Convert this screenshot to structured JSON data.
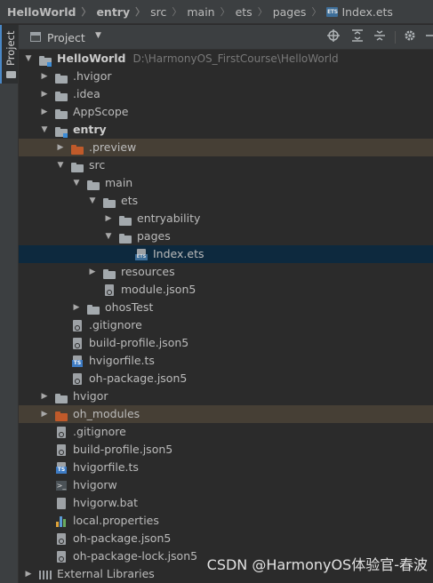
{
  "breadcrumb": {
    "items": [
      "HelloWorld",
      "entry",
      "src",
      "main",
      "ets",
      "pages",
      "Index.ets"
    ],
    "ets_badge": "ETS"
  },
  "side_stripe": {
    "label": "Project"
  },
  "toolbar": {
    "title": "Project",
    "dropdown_glyph": "▼",
    "buttons": [
      "locate-icon",
      "expand-all-icon",
      "collapse-all-icon",
      "gear-icon",
      "minimize-icon"
    ]
  },
  "tree": {
    "project_path": "D:\\HarmonyOS_FirstCourse\\HelloWorld",
    "rows": [
      {
        "label": "HelloWorld",
        "icon": "module-folder-icon",
        "arrow": "down",
        "depth": 0
      },
      {
        "label": ".hvigor",
        "icon": "folder-icon",
        "arrow": "right",
        "depth": 1
      },
      {
        "label": ".idea",
        "icon": "folder-icon",
        "arrow": "right",
        "depth": 1
      },
      {
        "label": "AppScope",
        "icon": "folder-icon",
        "arrow": "right",
        "depth": 1
      },
      {
        "label": "entry",
        "icon": "module-folder-icon",
        "arrow": "down",
        "depth": 1
      },
      {
        "label": ".preview",
        "icon": "orange-folder-icon",
        "arrow": "right",
        "depth": 2
      },
      {
        "label": "src",
        "icon": "folder-icon",
        "arrow": "down",
        "depth": 2
      },
      {
        "label": "main",
        "icon": "folder-icon",
        "arrow": "down",
        "depth": 3
      },
      {
        "label": "ets",
        "icon": "folder-icon",
        "arrow": "down",
        "depth": 4
      },
      {
        "label": "entryability",
        "icon": "folder-icon",
        "arrow": "right",
        "depth": 5
      },
      {
        "label": "pages",
        "icon": "folder-icon",
        "arrow": "down",
        "depth": 5
      },
      {
        "label": "Index.ets",
        "icon": "ets-file-icon",
        "arrow": "none",
        "depth": 6
      },
      {
        "label": "resources",
        "icon": "folder-icon",
        "arrow": "right",
        "depth": 4
      },
      {
        "label": "module.json5",
        "icon": "json-file-icon",
        "arrow": "none",
        "depth": 4
      },
      {
        "label": "ohosTest",
        "icon": "folder-icon",
        "arrow": "right",
        "depth": 3
      },
      {
        "label": ".gitignore",
        "icon": "gitignore-file-icon",
        "arrow": "none",
        "depth": 2
      },
      {
        "label": "build-profile.json5",
        "icon": "json-file-icon",
        "arrow": "none",
        "depth": 2
      },
      {
        "label": "hvigorfile.ts",
        "icon": "ts-file-icon",
        "arrow": "none",
        "depth": 2
      },
      {
        "label": "oh-package.json5",
        "icon": "json-file-icon",
        "arrow": "none",
        "depth": 2
      },
      {
        "label": "hvigor",
        "icon": "folder-icon",
        "arrow": "right",
        "depth": 1
      },
      {
        "label": "oh_modules",
        "icon": "orange-folder-icon",
        "arrow": "right",
        "depth": 1
      },
      {
        "label": ".gitignore",
        "icon": "gitignore-file-icon",
        "arrow": "none",
        "depth": 1
      },
      {
        "label": "build-profile.json5",
        "icon": "json-file-icon",
        "arrow": "none",
        "depth": 1
      },
      {
        "label": "hvigorfile.ts",
        "icon": "ts-file-icon",
        "arrow": "none",
        "depth": 1
      },
      {
        "label": "hvigorw",
        "icon": "terminal-file-icon",
        "arrow": "none",
        "depth": 1
      },
      {
        "label": "hvigorw.bat",
        "icon": "text-file-icon",
        "arrow": "none",
        "depth": 1
      },
      {
        "label": "local.properties",
        "icon": "properties-file-icon",
        "arrow": "none",
        "depth": 1
      },
      {
        "label": "oh-package.json5",
        "icon": "json-file-icon",
        "arrow": "none",
        "depth": 1
      },
      {
        "label": "oh-package-lock.json5",
        "icon": "json-file-icon",
        "arrow": "none",
        "depth": 1
      },
      {
        "label": "External Libraries",
        "icon": "libraries-icon",
        "arrow": "right",
        "depth": 0
      }
    ],
    "selected_label": "Index.ets",
    "highlighted_labels": [
      ".preview",
      "oh_modules"
    ],
    "badges": {
      "ts": "TS",
      "ets": "ETS",
      "term": ">_"
    }
  },
  "colors": {
    "background": "#2b2b2b",
    "panel": "#3c3f41",
    "selection": "#0d293e",
    "excluded_highlight": "#463f35",
    "excluded_folder": "#c05a2a",
    "module_marker": "#3d8cd6"
  },
  "watermark": "CSDN @HarmonyOS体验官-春波"
}
